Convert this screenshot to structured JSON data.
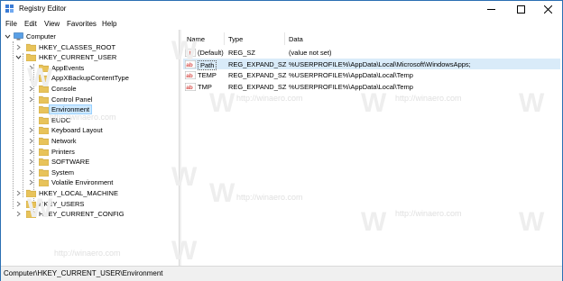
{
  "window": {
    "title": "Registry Editor",
    "icons": {
      "app": "registry-icon",
      "minimize": "minimize-icon",
      "maximize": "maximize-icon",
      "close": "close-icon"
    }
  },
  "menu": [
    "File",
    "Edit",
    "View",
    "Favorites",
    "Help"
  ],
  "tree": {
    "root": "Computer",
    "hives": {
      "classes_root": "HKEY_CLASSES_ROOT",
      "current_user": "HKEY_CURRENT_USER",
      "local_machine": "HKEY_LOCAL_MACHINE",
      "users": "HKEY_USERS",
      "current_config": "HKEY_CURRENT_CONFIG"
    },
    "current_user_children": [
      "AppEvents",
      "AppXBackupContentType",
      "Console",
      "Control Panel",
      "Environment",
      "EUDC",
      "Keyboard Layout",
      "Network",
      "Printers",
      "SOFTWARE",
      "System",
      "Volatile Environment"
    ],
    "selected": "Environment"
  },
  "list": {
    "headers": {
      "name": "Name",
      "type": "Type",
      "data": "Data"
    },
    "rows": [
      {
        "name": "(Default)",
        "type": "REG_SZ",
        "data": "(value not set)"
      },
      {
        "name": "Path",
        "type": "REG_EXPAND_SZ",
        "data": "%USERPROFILE%\\AppData\\Local\\Microsoft\\WindowsApps;"
      },
      {
        "name": "TEMP",
        "type": "REG_EXPAND_SZ",
        "data": "%USERPROFILE%\\AppData\\Local\\Temp"
      },
      {
        "name": "TMP",
        "type": "REG_EXPAND_SZ",
        "data": "%USERPROFILE%\\AppData\\Local\\Temp"
      }
    ],
    "selected_row": "Path",
    "value_icon_text": "ab"
  },
  "status": {
    "path": "Computer\\HKEY_CURRENT_USER\\Environment"
  },
  "watermark": {
    "letter": "W",
    "text": "http://winaero.com"
  },
  "colors": {
    "folder": "#e8c35a",
    "selection": "#cce8ff",
    "ab_icon": "#d9534f",
    "title_border": "#2b6fb3"
  }
}
